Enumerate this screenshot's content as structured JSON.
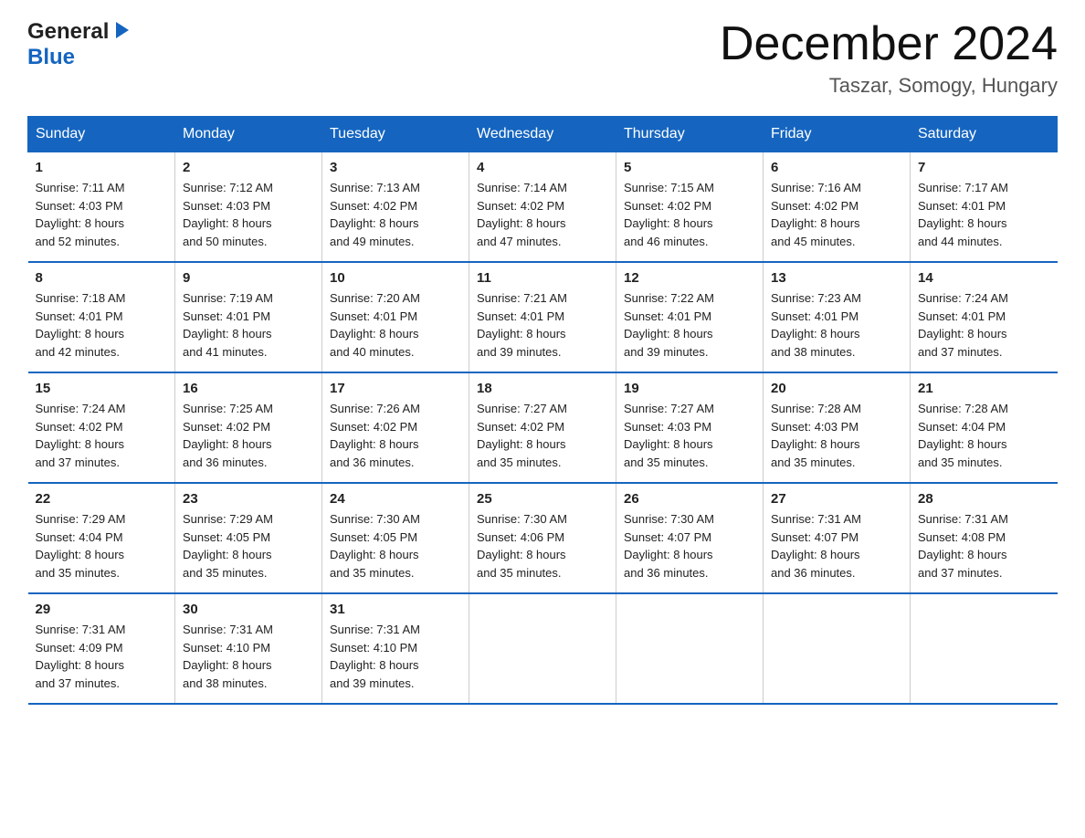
{
  "logo": {
    "general": "General",
    "blue": "Blue"
  },
  "header": {
    "title": "December 2024",
    "location": "Taszar, Somogy, Hungary"
  },
  "days_of_week": [
    "Sunday",
    "Monday",
    "Tuesday",
    "Wednesday",
    "Thursday",
    "Friday",
    "Saturday"
  ],
  "weeks": [
    [
      {
        "day": "1",
        "sunrise": "Sunrise: 7:11 AM",
        "sunset": "Sunset: 4:03 PM",
        "daylight": "Daylight: 8 hours",
        "minutes": "and 52 minutes."
      },
      {
        "day": "2",
        "sunrise": "Sunrise: 7:12 AM",
        "sunset": "Sunset: 4:03 PM",
        "daylight": "Daylight: 8 hours",
        "minutes": "and 50 minutes."
      },
      {
        "day": "3",
        "sunrise": "Sunrise: 7:13 AM",
        "sunset": "Sunset: 4:02 PM",
        "daylight": "Daylight: 8 hours",
        "minutes": "and 49 minutes."
      },
      {
        "day": "4",
        "sunrise": "Sunrise: 7:14 AM",
        "sunset": "Sunset: 4:02 PM",
        "daylight": "Daylight: 8 hours",
        "minutes": "and 47 minutes."
      },
      {
        "day": "5",
        "sunrise": "Sunrise: 7:15 AM",
        "sunset": "Sunset: 4:02 PM",
        "daylight": "Daylight: 8 hours",
        "minutes": "and 46 minutes."
      },
      {
        "day": "6",
        "sunrise": "Sunrise: 7:16 AM",
        "sunset": "Sunset: 4:02 PM",
        "daylight": "Daylight: 8 hours",
        "minutes": "and 45 minutes."
      },
      {
        "day": "7",
        "sunrise": "Sunrise: 7:17 AM",
        "sunset": "Sunset: 4:01 PM",
        "daylight": "Daylight: 8 hours",
        "minutes": "and 44 minutes."
      }
    ],
    [
      {
        "day": "8",
        "sunrise": "Sunrise: 7:18 AM",
        "sunset": "Sunset: 4:01 PM",
        "daylight": "Daylight: 8 hours",
        "minutes": "and 42 minutes."
      },
      {
        "day": "9",
        "sunrise": "Sunrise: 7:19 AM",
        "sunset": "Sunset: 4:01 PM",
        "daylight": "Daylight: 8 hours",
        "minutes": "and 41 minutes."
      },
      {
        "day": "10",
        "sunrise": "Sunrise: 7:20 AM",
        "sunset": "Sunset: 4:01 PM",
        "daylight": "Daylight: 8 hours",
        "minutes": "and 40 minutes."
      },
      {
        "day": "11",
        "sunrise": "Sunrise: 7:21 AM",
        "sunset": "Sunset: 4:01 PM",
        "daylight": "Daylight: 8 hours",
        "minutes": "and 39 minutes."
      },
      {
        "day": "12",
        "sunrise": "Sunrise: 7:22 AM",
        "sunset": "Sunset: 4:01 PM",
        "daylight": "Daylight: 8 hours",
        "minutes": "and 39 minutes."
      },
      {
        "day": "13",
        "sunrise": "Sunrise: 7:23 AM",
        "sunset": "Sunset: 4:01 PM",
        "daylight": "Daylight: 8 hours",
        "minutes": "and 38 minutes."
      },
      {
        "day": "14",
        "sunrise": "Sunrise: 7:24 AM",
        "sunset": "Sunset: 4:01 PM",
        "daylight": "Daylight: 8 hours",
        "minutes": "and 37 minutes."
      }
    ],
    [
      {
        "day": "15",
        "sunrise": "Sunrise: 7:24 AM",
        "sunset": "Sunset: 4:02 PM",
        "daylight": "Daylight: 8 hours",
        "minutes": "and 37 minutes."
      },
      {
        "day": "16",
        "sunrise": "Sunrise: 7:25 AM",
        "sunset": "Sunset: 4:02 PM",
        "daylight": "Daylight: 8 hours",
        "minutes": "and 36 minutes."
      },
      {
        "day": "17",
        "sunrise": "Sunrise: 7:26 AM",
        "sunset": "Sunset: 4:02 PM",
        "daylight": "Daylight: 8 hours",
        "minutes": "and 36 minutes."
      },
      {
        "day": "18",
        "sunrise": "Sunrise: 7:27 AM",
        "sunset": "Sunset: 4:02 PM",
        "daylight": "Daylight: 8 hours",
        "minutes": "and 35 minutes."
      },
      {
        "day": "19",
        "sunrise": "Sunrise: 7:27 AM",
        "sunset": "Sunset: 4:03 PM",
        "daylight": "Daylight: 8 hours",
        "minutes": "and 35 minutes."
      },
      {
        "day": "20",
        "sunrise": "Sunrise: 7:28 AM",
        "sunset": "Sunset: 4:03 PM",
        "daylight": "Daylight: 8 hours",
        "minutes": "and 35 minutes."
      },
      {
        "day": "21",
        "sunrise": "Sunrise: 7:28 AM",
        "sunset": "Sunset: 4:04 PM",
        "daylight": "Daylight: 8 hours",
        "minutes": "and 35 minutes."
      }
    ],
    [
      {
        "day": "22",
        "sunrise": "Sunrise: 7:29 AM",
        "sunset": "Sunset: 4:04 PM",
        "daylight": "Daylight: 8 hours",
        "minutes": "and 35 minutes."
      },
      {
        "day": "23",
        "sunrise": "Sunrise: 7:29 AM",
        "sunset": "Sunset: 4:05 PM",
        "daylight": "Daylight: 8 hours",
        "minutes": "and 35 minutes."
      },
      {
        "day": "24",
        "sunrise": "Sunrise: 7:30 AM",
        "sunset": "Sunset: 4:05 PM",
        "daylight": "Daylight: 8 hours",
        "minutes": "and 35 minutes."
      },
      {
        "day": "25",
        "sunrise": "Sunrise: 7:30 AM",
        "sunset": "Sunset: 4:06 PM",
        "daylight": "Daylight: 8 hours",
        "minutes": "and 35 minutes."
      },
      {
        "day": "26",
        "sunrise": "Sunrise: 7:30 AM",
        "sunset": "Sunset: 4:07 PM",
        "daylight": "Daylight: 8 hours",
        "minutes": "and 36 minutes."
      },
      {
        "day": "27",
        "sunrise": "Sunrise: 7:31 AM",
        "sunset": "Sunset: 4:07 PM",
        "daylight": "Daylight: 8 hours",
        "minutes": "and 36 minutes."
      },
      {
        "day": "28",
        "sunrise": "Sunrise: 7:31 AM",
        "sunset": "Sunset: 4:08 PM",
        "daylight": "Daylight: 8 hours",
        "minutes": "and 37 minutes."
      }
    ],
    [
      {
        "day": "29",
        "sunrise": "Sunrise: 7:31 AM",
        "sunset": "Sunset: 4:09 PM",
        "daylight": "Daylight: 8 hours",
        "minutes": "and 37 minutes."
      },
      {
        "day": "30",
        "sunrise": "Sunrise: 7:31 AM",
        "sunset": "Sunset: 4:10 PM",
        "daylight": "Daylight: 8 hours",
        "minutes": "and 38 minutes."
      },
      {
        "day": "31",
        "sunrise": "Sunrise: 7:31 AM",
        "sunset": "Sunset: 4:10 PM",
        "daylight": "Daylight: 8 hours",
        "minutes": "and 39 minutes."
      },
      null,
      null,
      null,
      null
    ]
  ]
}
